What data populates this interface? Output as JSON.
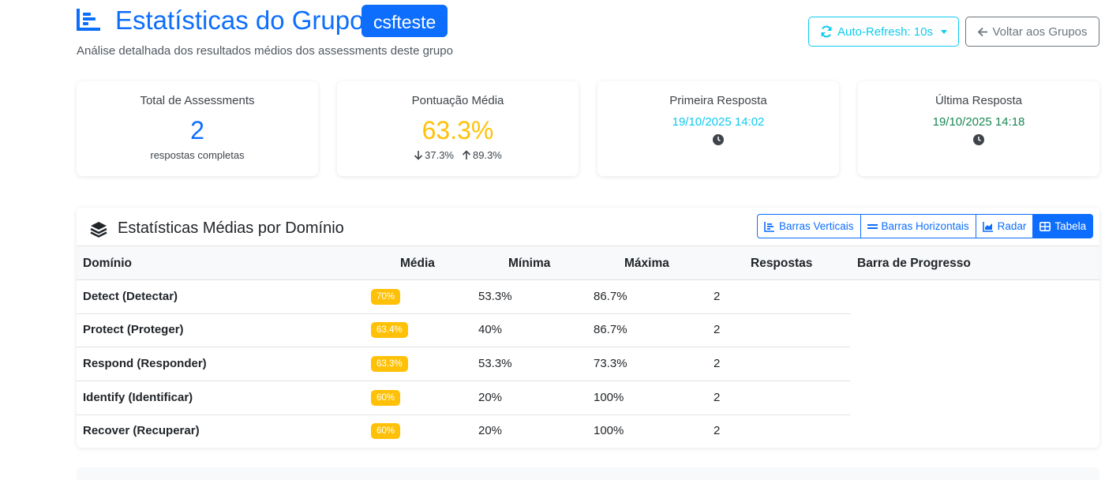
{
  "header": {
    "title": "Estatísticas do Grupo:",
    "group_name": "csfteste",
    "subtitle": "Análise detalhada dos resultados médios dos assessments deste grupo",
    "auto_refresh_label": "Auto-Refresh: 10s",
    "back_label": "Voltar aos Grupos"
  },
  "cards": {
    "total": {
      "label": "Total de Assessments",
      "value": "2",
      "caption": "respostas completas"
    },
    "score": {
      "label": "Pontuação Média",
      "value": "63.3%",
      "min": "37.3%",
      "max": "89.3%"
    },
    "first": {
      "label": "Primeira Resposta",
      "date": "19/10/2025 14:02"
    },
    "last": {
      "label": "Última Resposta",
      "date": "19/10/2025 14:18"
    }
  },
  "domain_section": {
    "title": "Estatísticas Médias por Domínio",
    "views": [
      "Barras Verticais",
      "Barras Horizontais",
      "Radar",
      "Tabela"
    ],
    "active_view": "Tabela",
    "columns": [
      "Domínio",
      "Média",
      "Mínima",
      "Máxima",
      "Respostas",
      "Barra de Progresso"
    ],
    "rows": [
      {
        "domain": "Detect (Detectar)",
        "avg": "70%",
        "min": "53.3%",
        "max": "86.7%",
        "responses": "2"
      },
      {
        "domain": "Protect (Proteger)",
        "avg": "63.4%",
        "min": "40%",
        "max": "86.7%",
        "responses": "2"
      },
      {
        "domain": "Respond (Responder)",
        "avg": "63.3%",
        "min": "53.3%",
        "max": "73.3%",
        "responses": "2"
      },
      {
        "domain": "Identify (Identificar)",
        "avg": "60%",
        "min": "20%",
        "max": "100%",
        "responses": "2"
      },
      {
        "domain": "Recover (Recuperar)",
        "avg": "60%",
        "min": "20%",
        "max": "100%",
        "responses": "2"
      }
    ]
  },
  "colors": {
    "primary": "#0d6efd",
    "info": "#0dcaf0",
    "warning": "#ffc107",
    "success": "#198754",
    "secondary": "#6c757d"
  },
  "icons": {
    "title": "chart-bar-icon",
    "refresh": "sync-icon",
    "back": "arrow-left-icon",
    "section": "layers-icon",
    "clock": "clock-icon"
  }
}
